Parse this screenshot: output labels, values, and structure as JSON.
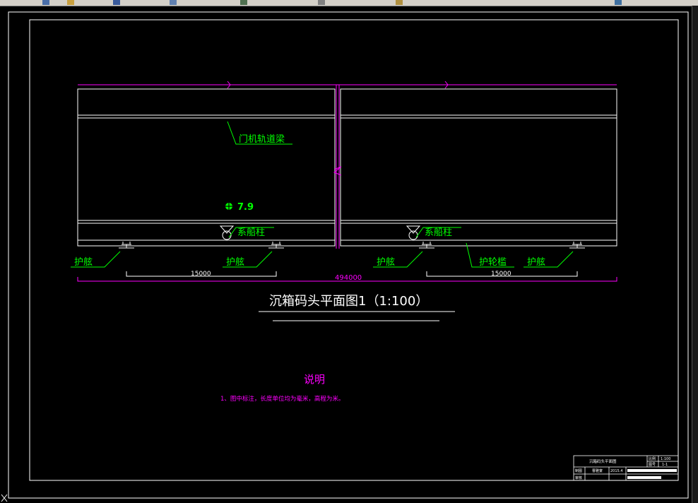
{
  "colors": {
    "background": "#000000",
    "frame": "#ffffff",
    "magenta": "#ff00ff",
    "green": "#00ff00",
    "toolbar": "#d4d0c8"
  },
  "toolbar": {
    "icons": [
      "undo-icon",
      "redo-icon",
      "zoom-icon",
      "pan-icon",
      "properties-icon",
      "layer-icon",
      "settings-icon",
      "help-icon"
    ]
  },
  "drawing": {
    "labels": {
      "crane_beam": "门机轨道梁",
      "elevation": "7.9",
      "bollard_1": "系船柱",
      "bollard_2": "系船柱",
      "fender_1": "护舷",
      "fender_2": "护舷",
      "fender_3": "护舷",
      "fender_4": "护舷",
      "wheel_guard": "护轮槛"
    },
    "dimensions": {
      "total": "494000",
      "spacing_left": "15000",
      "spacing_right": "15000"
    },
    "title": "沉箱码头平面图1（1:100）",
    "notes_title": "说明",
    "notes_line": "1、图中标注，长度单位均为毫米，高程为米。"
  },
  "title_block": {
    "drawing_name": "沉箱码头平面图",
    "scale_label": "比例",
    "scale_value": "1:100",
    "sheet_label": "图号",
    "sheet_value": "1-1",
    "drawn_label": "制图",
    "drawn_name": "曹雅宴",
    "date": "2015.4",
    "check_label": "审核"
  }
}
